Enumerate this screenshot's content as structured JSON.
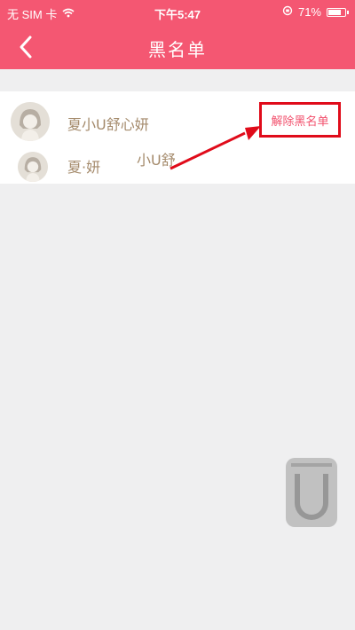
{
  "status_bar": {
    "carrier": "无 SIM 卡",
    "time": "下午5:47",
    "battery": "71%",
    "battery_level": 0.71
  },
  "header": {
    "title": "黑名单"
  },
  "blacklist": {
    "items": [
      {
        "name": "夏小U舒心妍"
      },
      {
        "name": "夏·妍"
      },
      {
        "name": "小U舒"
      }
    ],
    "unblock_label": "解除黑名单"
  },
  "colors": {
    "accent": "#f45772",
    "name_color": "#a48a6b",
    "highlight_border": "#e00b1a",
    "background": "#efeff0"
  }
}
